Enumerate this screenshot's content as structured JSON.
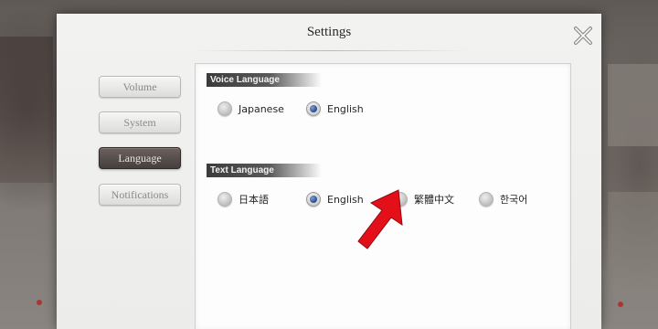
{
  "window": {
    "title": "Settings"
  },
  "tabs": [
    {
      "label": "Volume",
      "active": false
    },
    {
      "label": "System",
      "active": false
    },
    {
      "label": "Language",
      "active": true
    },
    {
      "label": "Notifications",
      "active": false
    }
  ],
  "voice_language": {
    "header": "Voice Language",
    "options": [
      {
        "label": "Japanese",
        "selected": false
      },
      {
        "label": "English",
        "selected": true
      }
    ]
  },
  "text_language": {
    "header": "Text Language",
    "options": [
      {
        "label": "日本語",
        "selected": false
      },
      {
        "label": "English",
        "selected": true
      },
      {
        "label": "繁體中文",
        "selected": false
      },
      {
        "label": "한국어",
        "selected": false
      }
    ]
  },
  "colors": {
    "accent_arrow": "#e3101a",
    "radio_selected": "#25488c",
    "active_tab": "#4f4643"
  },
  "icons": {
    "close": "close-x-icon",
    "pointer": "red-arrow-icon"
  }
}
